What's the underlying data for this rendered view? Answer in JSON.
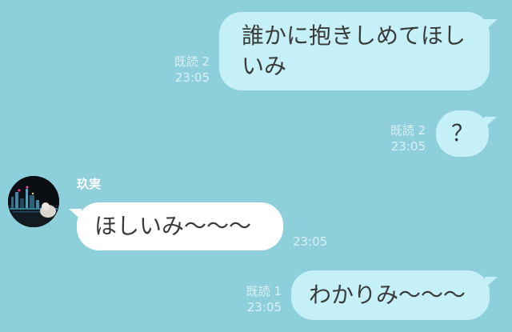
{
  "chat": {
    "messages": [
      {
        "side": "sent",
        "lines": [
          "誰かに抱きしめてほし",
          "いみ"
        ],
        "read": "既読 2",
        "time": "23:05"
      },
      {
        "side": "sent",
        "lines": [
          "？"
        ],
        "read": "既読 2",
        "time": "23:05"
      },
      {
        "side": "received",
        "sender": "玖実",
        "lines": [
          "ほしいみ〜〜〜"
        ],
        "time": "23:05"
      },
      {
        "side": "sent",
        "lines": [
          "わかりみ〜〜〜"
        ],
        "read": "既読 1",
        "time": "23:05"
      }
    ]
  },
  "colors": {
    "background": "#8ecfdc",
    "sent_bubble": "#c6f0f7",
    "received_bubble": "#ffffff",
    "text": "#3a3a3a"
  },
  "icons": {
    "avatar": "night-cityscape-photo"
  }
}
